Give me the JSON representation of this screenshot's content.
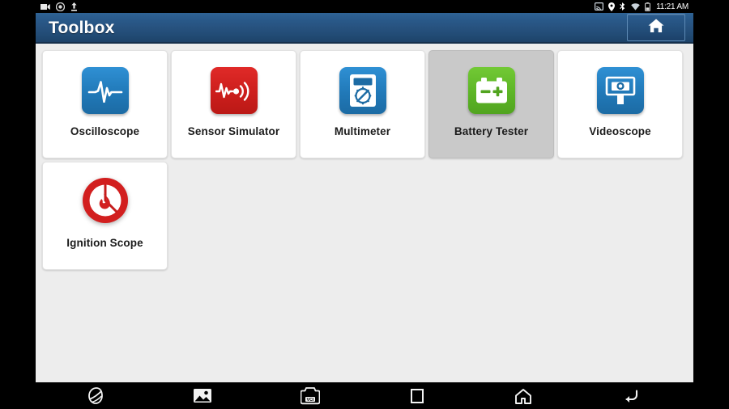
{
  "statusbar": {
    "left_icons": [
      "video-camera-icon",
      "screen-record-icon",
      "upload-icon"
    ],
    "right_icons": [
      "screencast-icon",
      "location-pin-icon",
      "bluetooth-icon",
      "wifi-icon",
      "battery-icon"
    ],
    "time": "11:21 AM"
  },
  "titlebar": {
    "title": "Toolbox",
    "home_button_icon": "home-icon"
  },
  "colors": {
    "title_bar_blue": "#27527f",
    "icon_blue": "#2179b8",
    "icon_red": "#cc1e1c",
    "icon_green": "#5db526",
    "content_bg": "#ededed",
    "tile_bg": "#ffffff",
    "tile_selected_bg": "#c9c9c9"
  },
  "tiles": [
    {
      "label": "Oscilloscope",
      "icon": "waveform-icon",
      "color": "blue",
      "selected": false
    },
    {
      "label": "Sensor Simulator",
      "icon": "signal-waveform-icon",
      "color": "red",
      "selected": false
    },
    {
      "label": "Multimeter",
      "icon": "multimeter-icon",
      "color": "blue",
      "selected": false
    },
    {
      "label": "Battery Tester",
      "icon": "battery-icon",
      "color": "green",
      "selected": true
    },
    {
      "label": "Videoscope",
      "icon": "camera-scope-icon",
      "color": "blue",
      "selected": false
    },
    {
      "label": "Ignition Scope",
      "icon": "ignition-flame-icon",
      "color": "red-circle",
      "selected": false
    }
  ],
  "navbar": {
    "left_icons": [
      "browser-icon",
      "gallery-icon",
      "vci-device-icon"
    ],
    "right_icons": [
      "recents-icon",
      "home-icon",
      "back-icon"
    ]
  }
}
